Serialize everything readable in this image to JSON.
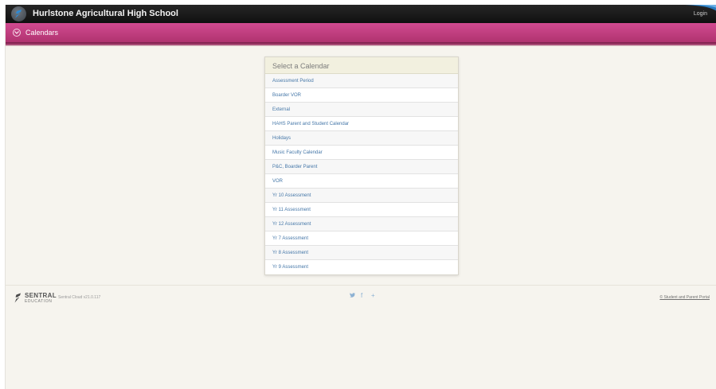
{
  "header": {
    "school_name": "Hurlstone Agricultural High School",
    "login_label": "Login",
    "logo_icon": "sentral-s-logo-icon"
  },
  "section": {
    "title": "Calendars",
    "icon": "chevron-down-circle-icon"
  },
  "calendar_panel": {
    "title": "Select a Calendar",
    "items": [
      {
        "label": "Assessment Period"
      },
      {
        "label": "Boarder VOR"
      },
      {
        "label": "External"
      },
      {
        "label": "HAHS Parent and Student Calendar"
      },
      {
        "label": "Holidays"
      },
      {
        "label": "Music Faculty Calendar"
      },
      {
        "label": "P&C, Boarder Parent"
      },
      {
        "label": "VOR"
      },
      {
        "label": "Yr 10 Assessment"
      },
      {
        "label": "Yr 11 Assessment"
      },
      {
        "label": "Yr 12 Assessment"
      },
      {
        "label": "Yr 7 Assessment"
      },
      {
        "label": "Yr 8 Assessment"
      },
      {
        "label": "Yr 9 Assessment"
      }
    ]
  },
  "footer": {
    "brand_top": "SENTRAL",
    "brand_bottom": "EDUCATION",
    "version": "Sentral Cloud v21.0.117",
    "portal_link": "© Student and Parent Portal",
    "social_icons": [
      "twitter-icon",
      "facebook-icon",
      "google-plus-icon"
    ],
    "social_glyphs": {
      "twitter": "✉",
      "facebook": "f",
      "google": "+"
    }
  },
  "colors": {
    "topbar": "#1a1a1a",
    "section_bar": "#c2407f",
    "link": "#4577a8",
    "page_background": "#f6f4ee"
  }
}
